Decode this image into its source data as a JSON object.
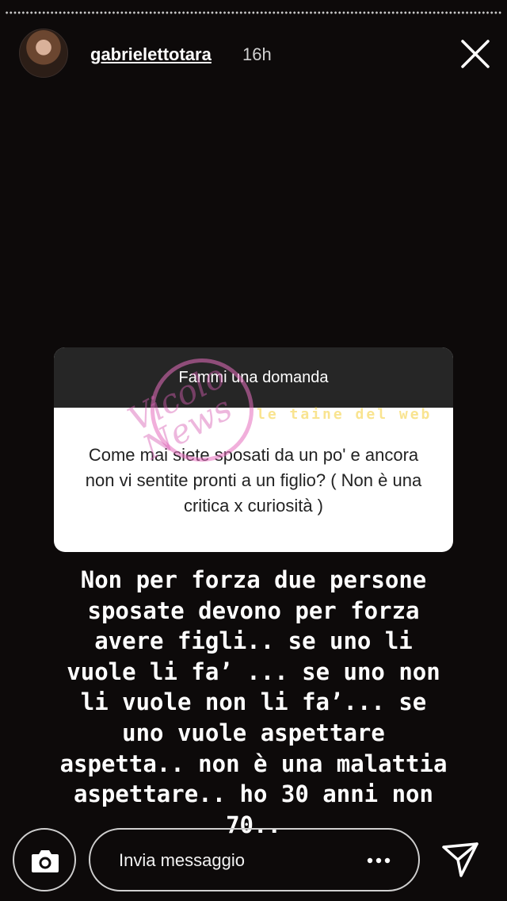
{
  "header": {
    "username": "gabrielettotara",
    "time_ago": "16h"
  },
  "question_card": {
    "title": "Fammi una domanda",
    "question": "Come mai siete sposati da un po' e ancora non vi sentite pronti a un figlio? ( Non è una critica x curiosità )"
  },
  "watermarks": {
    "primary": "Vicolo delle News",
    "secondary": "le taine del web"
  },
  "story_text": "Non per forza due persone\nsposate devono per forza\navere figli.. se uno li\nvuole li fa’ ... se uno non\nli vuole non li fa’... se\nuno vuole aspettare\naspetta.. non è una malattia\naspettare.. ho 30 anni non\n70..",
  "reply_bar": {
    "placeholder": "Invia messaggio"
  },
  "icons": {
    "close": "close-icon",
    "camera": "camera-icon",
    "more": "more-icon",
    "send": "send-icon"
  }
}
